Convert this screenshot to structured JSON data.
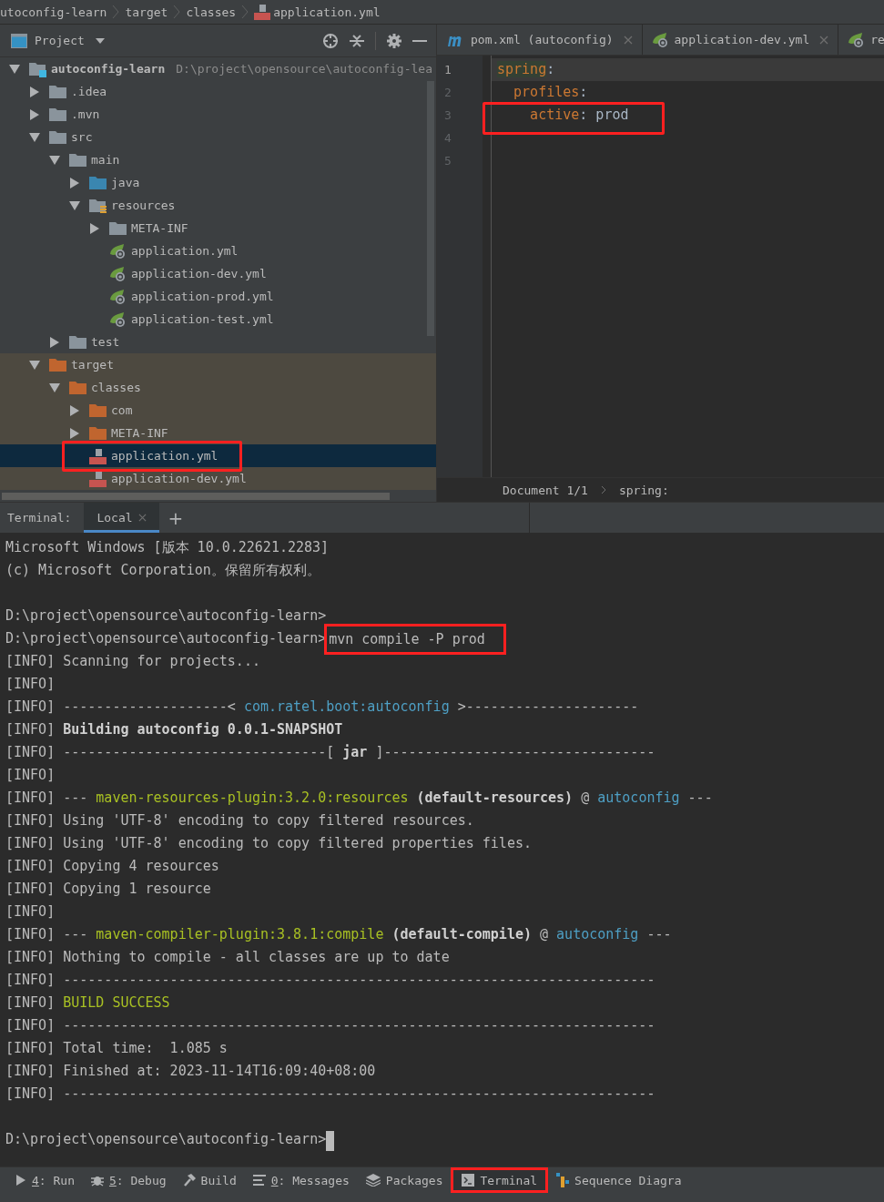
{
  "breadcrumb": [
    {
      "label": "utoconfig-learn",
      "kind": "folder"
    },
    {
      "label": "target",
      "kind": "folder"
    },
    {
      "label": "classes",
      "kind": "folder"
    },
    {
      "label": "application.yml",
      "kind": "yml"
    }
  ],
  "project_panel": {
    "title": "Project"
  },
  "tree": [
    {
      "name": "autoconfig-learn",
      "kind": "module",
      "path": "D:\\project\\opensource\\autoconfig-lea",
      "expanded": true,
      "selected": false,
      "children": [
        {
          "name": ".idea",
          "kind": "folder",
          "expanded": false,
          "selected": false
        },
        {
          "name": ".mvn",
          "kind": "folder",
          "expanded": false,
          "selected": false
        },
        {
          "name": "src",
          "kind": "folder",
          "expanded": true,
          "selected": false,
          "children": [
            {
              "name": "main",
              "kind": "folder",
              "expanded": true,
              "selected": false,
              "children": [
                {
                  "name": "java",
                  "kind": "source-folder",
                  "expanded": false,
                  "selected": false
                },
                {
                  "name": "resources",
                  "kind": "resources-folder",
                  "expanded": true,
                  "selected": false,
                  "children": [
                    {
                      "name": "META-INF",
                      "kind": "folder",
                      "expanded": false,
                      "selected": false
                    },
                    {
                      "name": "application.yml",
                      "kind": "spring-yml",
                      "selected": false
                    },
                    {
                      "name": "application-dev.yml",
                      "kind": "spring-yml",
                      "selected": false
                    },
                    {
                      "name": "application-prod.yml",
                      "kind": "spring-yml",
                      "selected": false
                    },
                    {
                      "name": "application-test.yml",
                      "kind": "spring-yml",
                      "selected": false
                    }
                  ]
                }
              ]
            },
            {
              "name": "test",
              "kind": "folder",
              "expanded": false,
              "selected": false
            }
          ]
        },
        {
          "name": "target",
          "kind": "excluded-folder",
          "excluded": true,
          "expanded": true,
          "selected": false,
          "children": [
            {
              "name": "classes",
              "kind": "excluded-folder",
              "expanded": true,
              "selected": false,
              "children": [
                {
                  "name": "com",
                  "kind": "excluded-folder",
                  "expanded": false,
                  "selected": false
                },
                {
                  "name": "META-INF",
                  "kind": "excluded-folder",
                  "expanded": false,
                  "selected": false
                },
                {
                  "name": "application.yml",
                  "kind": "yml",
                  "selected": true,
                  "annotated": true
                },
                {
                  "name": "application-dev.yml",
                  "kind": "yml",
                  "selected": false
                }
              ]
            }
          ]
        }
      ]
    }
  ],
  "editor_tabs": [
    {
      "label": "pom.xml (autoconfig)",
      "kind": "maven"
    },
    {
      "label": "application-dev.yml",
      "kind": "spring-yml"
    },
    {
      "label": "re",
      "kind": "spring-yml"
    }
  ],
  "editor_lines": [
    {
      "number": "1",
      "current": true,
      "segments": [
        {
          "text": "spring",
          "kind": "key",
          "highlighted": true
        },
        {
          "text": ":",
          "kind": "punct"
        }
      ]
    },
    {
      "number": "2",
      "current": false,
      "segments": [
        {
          "text": "  profiles",
          "kind": "key"
        },
        {
          "text": ":",
          "kind": "punct"
        }
      ]
    },
    {
      "number": "3",
      "current": false,
      "annotated": true,
      "segments": [
        {
          "text": "    active",
          "kind": "key"
        },
        {
          "text": ": prod",
          "kind": "value"
        }
      ]
    },
    {
      "number": "4",
      "current": false
    },
    {
      "number": "5",
      "current": false
    }
  ],
  "editor_footer": [
    "Document 1/1",
    "spring:"
  ],
  "terminal": {
    "label": "Terminal:",
    "tabs": [
      {
        "label": "Local",
        "selected": true
      }
    ],
    "add": "+"
  },
  "terminal_lines": [
    {
      "segments": [
        {
          "text": "Microsoft Windows [版本 10.0.22621.2283]",
          "kind": "plain"
        }
      ]
    },
    {
      "segments": [
        {
          "text": "(c) Microsoft Corporation。保留所有权利。",
          "kind": "plain"
        }
      ]
    },
    {
      "gap_before": true,
      "segments": [
        {
          "text": "D:\\project\\opensource\\autoconfig-learn>",
          "kind": "plain"
        }
      ]
    },
    {
      "segments": [
        {
          "text": "D:\\project\\opensource\\autoconfig-learn>",
          "kind": "plain"
        },
        {
          "text": "mvn compile -P prod",
          "kind": "plain",
          "annotated": true
        }
      ]
    },
    {
      "segments": [
        {
          "text": "[INFO] Scanning for projects...",
          "kind": "plain"
        }
      ]
    },
    {
      "segments": [
        {
          "text": "[INFO]",
          "kind": "plain"
        }
      ]
    },
    {
      "segments": [
        {
          "text": "[INFO] --------------------< ",
          "kind": "plain"
        },
        {
          "text": "com.ratel.boot:autoconfig",
          "kind": "module"
        },
        {
          "text": " >---------------------",
          "kind": "plain"
        }
      ]
    },
    {
      "segments": [
        {
          "text": "[INFO] ",
          "kind": "plain"
        },
        {
          "text": "Building autoconfig 0.0.1-SNAPSHOT",
          "kind": "bold"
        }
      ]
    },
    {
      "segments": [
        {
          "text": "[INFO] --------------------------------[ ",
          "kind": "plain"
        },
        {
          "text": "jar",
          "kind": "bold"
        },
        {
          "text": " ]---------------------------------",
          "kind": "plain"
        }
      ]
    },
    {
      "segments": [
        {
          "text": "[INFO]",
          "kind": "plain"
        }
      ]
    },
    {
      "segments": [
        {
          "text": "[INFO] --- ",
          "kind": "plain"
        },
        {
          "text": "maven-resources-plugin:3.2.0:resources",
          "kind": "plugin"
        },
        {
          "text": " (default-resources)",
          "kind": "bold"
        },
        {
          "text": " @ ",
          "kind": "plain"
        },
        {
          "text": "autoconfig",
          "kind": "module"
        },
        {
          "text": " ---",
          "kind": "plain"
        }
      ]
    },
    {
      "segments": [
        {
          "text": "[INFO] Using 'UTF-8' encoding to copy filtered resources.",
          "kind": "plain"
        }
      ]
    },
    {
      "segments": [
        {
          "text": "[INFO] Using 'UTF-8' encoding to copy filtered properties files.",
          "kind": "plain"
        }
      ]
    },
    {
      "segments": [
        {
          "text": "[INFO] Copying 4 resources",
          "kind": "plain"
        }
      ]
    },
    {
      "segments": [
        {
          "text": "[INFO] Copying 1 resource",
          "kind": "plain"
        }
      ]
    },
    {
      "segments": [
        {
          "text": "[INFO]",
          "kind": "plain"
        }
      ]
    },
    {
      "segments": [
        {
          "text": "[INFO] --- ",
          "kind": "plain"
        },
        {
          "text": "maven-compiler-plugin:3.8.1:compile",
          "kind": "plugin"
        },
        {
          "text": " (default-compile)",
          "kind": "bold"
        },
        {
          "text": " @ ",
          "kind": "plain"
        },
        {
          "text": "autoconfig",
          "kind": "module"
        },
        {
          "text": " ---",
          "kind": "plain"
        }
      ]
    },
    {
      "segments": [
        {
          "text": "[INFO] Nothing to compile - all classes are up to date",
          "kind": "plain"
        }
      ]
    },
    {
      "segments": [
        {
          "text": "[INFO] ------------------------------------------------------------------------",
          "kind": "plain"
        }
      ]
    },
    {
      "segments": [
        {
          "text": "[INFO] ",
          "kind": "plain"
        },
        {
          "text": "BUILD SUCCESS",
          "kind": "plugin"
        }
      ]
    },
    {
      "segments": [
        {
          "text": "[INFO] ------------------------------------------------------------------------",
          "kind": "plain"
        }
      ]
    },
    {
      "segments": [
        {
          "text": "[INFO] Total time:  1.085 s",
          "kind": "plain"
        }
      ]
    },
    {
      "segments": [
        {
          "text": "[INFO] Finished at: 2023-11-14T16:09:40+08:00",
          "kind": "plain"
        }
      ]
    },
    {
      "segments": [
        {
          "text": "[INFO] ------------------------------------------------------------------------",
          "kind": "plain"
        }
      ]
    },
    {
      "gap_before": true,
      "cursor": true,
      "segments": [
        {
          "text": "D:\\project\\opensource\\autoconfig-learn>",
          "kind": "plain"
        }
      ]
    }
  ],
  "tool_windows": [
    {
      "mnemonic": "4",
      "label": ": Run",
      "kind": "run",
      "selected": false
    },
    {
      "mnemonic": "5",
      "label": ": Debug",
      "kind": "debug",
      "selected": false
    },
    {
      "label": "Build",
      "kind": "build",
      "selected": false
    },
    {
      "mnemonic": "0",
      "label": ": Messages",
      "kind": "messages",
      "selected": false
    },
    {
      "label": "Packages",
      "kind": "packages",
      "selected": false
    },
    {
      "label": "Terminal",
      "kind": "terminal",
      "selected": true,
      "annotated": true
    },
    {
      "label": "Sequence Diagra",
      "kind": "sequence",
      "selected": false
    }
  ]
}
